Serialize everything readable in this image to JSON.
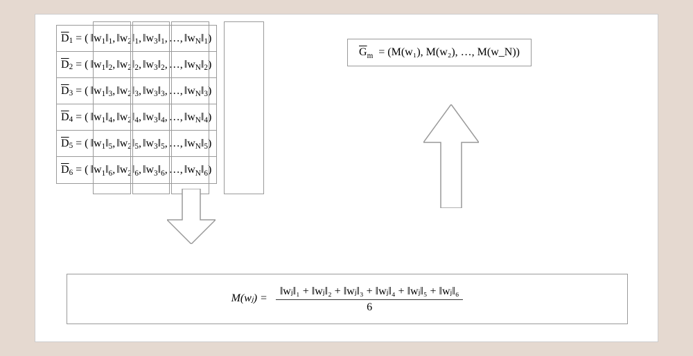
{
  "d_vectors": {
    "labels": [
      "D̅₁",
      "D̅₂",
      "D̅₃",
      "D̅₄",
      "D̅₅",
      "D̅₆"
    ],
    "row_pattern": "(‖w₁‖_i, ‖w₂‖_i, ‖w₃‖_i, …, ‖w_N‖_i)",
    "count": 6,
    "columns_shown": [
      "w₁",
      "w₂",
      "w₃",
      "…",
      "w_N"
    ]
  },
  "gm": {
    "lhs": "G̅",
    "lhs_sub": "m",
    "rhs": "(M(w₁), M(w₂), …, M(w_N))"
  },
  "m_formula": {
    "lhs": "M(wⱼ) =",
    "numerator": "‖wⱼ‖₁ + ‖wⱼ‖₂ + ‖wⱼ‖₃ + ‖wⱼ‖₄ + ‖wⱼ‖₅ + ‖wⱼ‖₆",
    "denominator": "6"
  },
  "flow": {
    "down_arrow": "columns-to-average",
    "up_arrow": "average-to-gm"
  }
}
